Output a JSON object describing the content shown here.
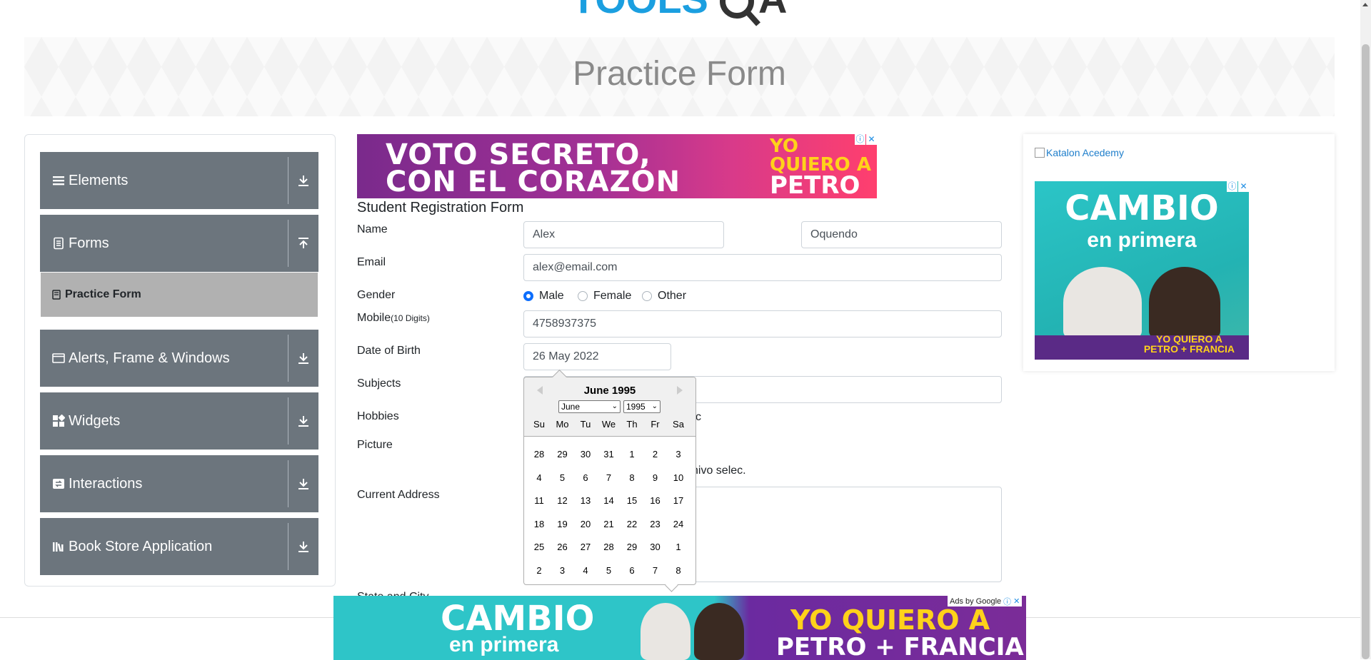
{
  "page": {
    "title": "Practice Form"
  },
  "logo": {
    "alt": "TOOLSQA"
  },
  "sidebar": {
    "groups": [
      {
        "label": "Elements",
        "icon": "menu-icon",
        "state": "collapsed"
      },
      {
        "label": "Forms",
        "icon": "document-icon",
        "state": "expanded"
      },
      {
        "label": "Alerts, Frame & Windows",
        "icon": "window-icon",
        "state": "collapsed"
      },
      {
        "label": "Widgets",
        "icon": "widgets-icon",
        "state": "collapsed"
      },
      {
        "label": "Interactions",
        "icon": "interactions-icon",
        "state": "collapsed"
      },
      {
        "label": "Book Store Application",
        "icon": "books-icon",
        "state": "collapsed"
      }
    ],
    "active_item": "Practice Form"
  },
  "ads": {
    "top": {
      "line1": "VOTO SECRETO,",
      "line2": "CON EL CORAZÓN",
      "line3": "YO QUIERO A",
      "line4": "PETRO"
    },
    "right": {
      "link_text": "Katalon Acedemy",
      "line1": "CAMBIO",
      "line2": "en primera",
      "line3a": "YO QUIERO A",
      "line3b": "PETRO + FRANCIA"
    },
    "bottom": {
      "line1": "CAMBIO",
      "line2": "en primera",
      "line3": "YO QUIERO A",
      "line4": "PETRO + FRANCIA",
      "ads_by": "Ads by Google"
    }
  },
  "form": {
    "heading": "Student Registration Form",
    "labels": {
      "name": "Name",
      "email": "Email",
      "gender": "Gender",
      "mobile": "Mobile",
      "mobile_hint": "(10 Digits)",
      "dob": "Date of Birth",
      "subjects": "Subjects",
      "hobbies": "Hobbies",
      "picture": "Picture",
      "address": "Current Address",
      "state_city": "State and City"
    },
    "first_name": "Alex",
    "last_name": "Oquendo",
    "email": "alex@email.com",
    "gender_options": [
      "Male",
      "Female",
      "Other"
    ],
    "gender_selected": "Male",
    "mobile": "4758937375",
    "dob": "26 May 2022",
    "hobbies_partial": "c",
    "picture_partial": "chivo selec."
  },
  "datepicker": {
    "title": "June 1995",
    "month_select": "June",
    "year_select": "1995",
    "weekdays": [
      "Su",
      "Mo",
      "Tu",
      "We",
      "Th",
      "Fr",
      "Sa"
    ],
    "weeks": [
      [
        "28",
        "29",
        "30",
        "31",
        "1",
        "2",
        "3"
      ],
      [
        "4",
        "5",
        "6",
        "7",
        "8",
        "9",
        "10"
      ],
      [
        "11",
        "12",
        "13",
        "14",
        "15",
        "16",
        "17"
      ],
      [
        "18",
        "19",
        "20",
        "21",
        "22",
        "23",
        "24"
      ],
      [
        "25",
        "26",
        "27",
        "28",
        "29",
        "30",
        "1"
      ],
      [
        "2",
        "3",
        "4",
        "5",
        "6",
        "7",
        "8"
      ]
    ]
  },
  "colors": {
    "sidebar_group": "#6c757d",
    "sidebar_active": "#b1b1b1",
    "radio_checked": "#0d6efd",
    "link": "#1e7ecb"
  }
}
